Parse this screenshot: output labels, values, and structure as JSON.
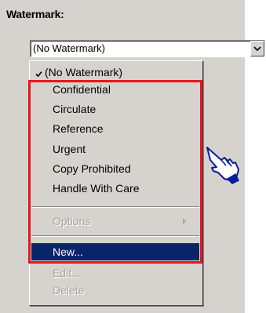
{
  "watermark": {
    "label": "Watermark:",
    "combo_value": "(No Watermark)"
  },
  "menu": {
    "checked_item": "(No Watermark)",
    "items": [
      "Confidential",
      "Circulate",
      "Reference",
      "Urgent",
      "Copy Prohibited",
      "Handle With Care"
    ],
    "options_label": "Options",
    "new_label": "New...",
    "edit_label": "Edit...",
    "delete_label": "Delete"
  },
  "colors": {
    "highlight": "#e8141d",
    "selection": "#0a246a",
    "pointer": "#0a1c9c"
  },
  "icons": {
    "pointer": "pointing-hand-icon",
    "check": "checkmark-icon",
    "dropdown": "chevron-down-icon",
    "submenu": "triangle-right-icon"
  }
}
